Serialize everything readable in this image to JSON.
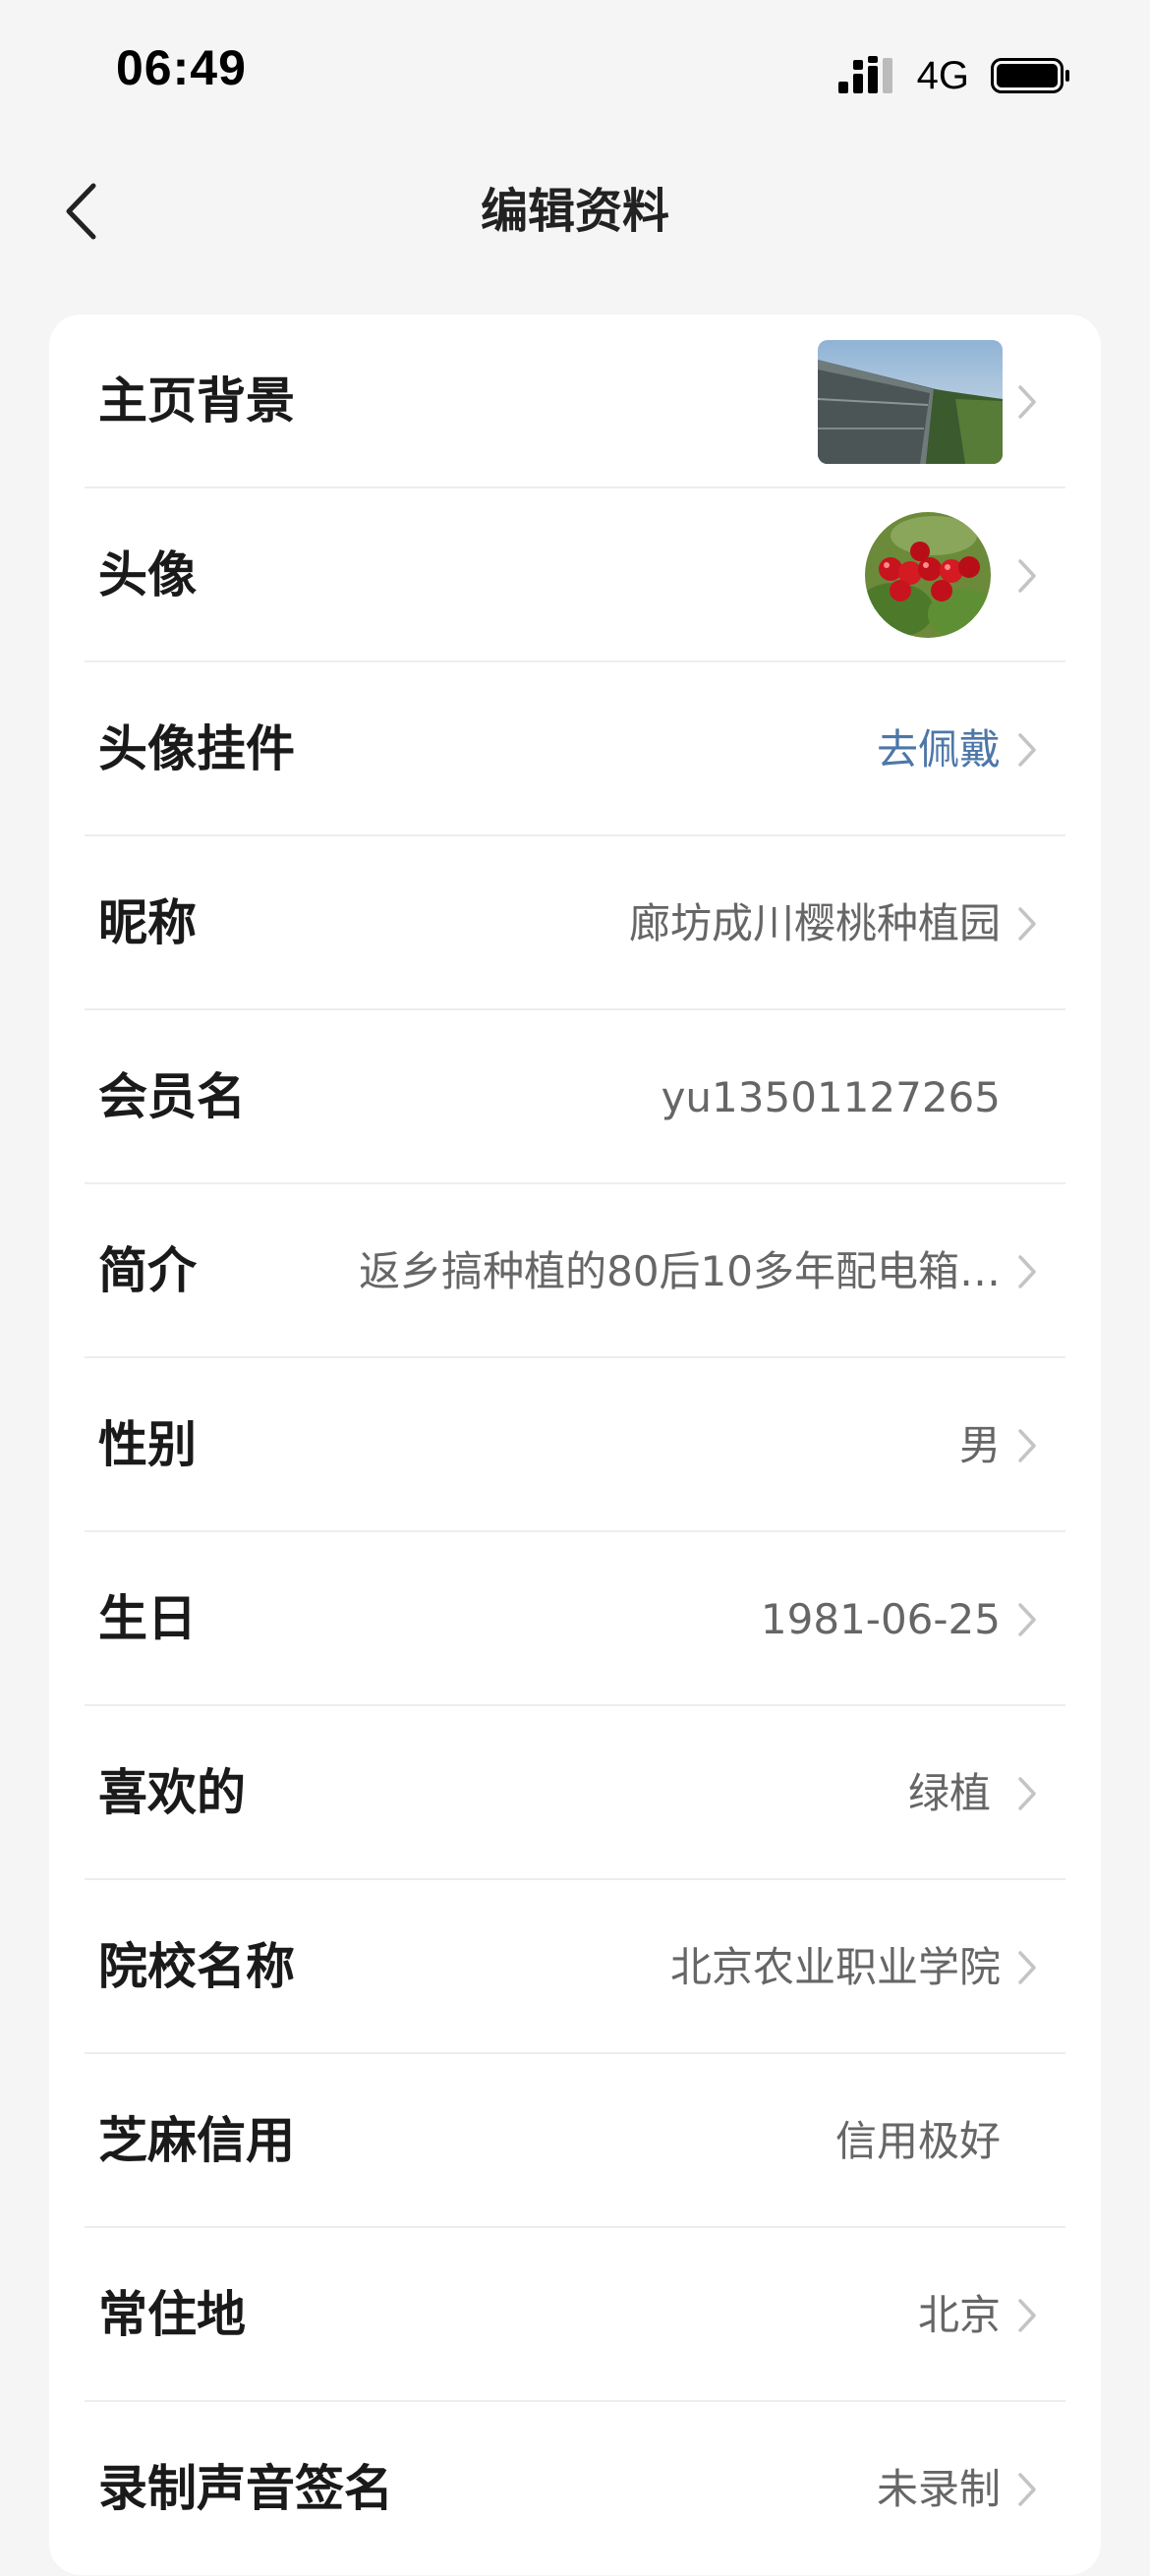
{
  "status_bar": {
    "time": "06:49",
    "network": "4G",
    "signal_icon": "signal-icon",
    "battery_icon": "battery-icon"
  },
  "nav": {
    "title": "编辑资料",
    "back_icon": "chevron-left-icon"
  },
  "rows": [
    {
      "label": "主页背景",
      "value": "",
      "kind": "image",
      "chevron": true
    },
    {
      "label": "头像",
      "value": "",
      "kind": "avatar",
      "chevron": true
    },
    {
      "label": "头像挂件",
      "value": "去佩戴",
      "kind": "link",
      "chevron": true
    },
    {
      "label": "昵称",
      "value": "廊坊成川樱桃种植园",
      "kind": "text",
      "chevron": true
    },
    {
      "label": "会员名",
      "value": "yu13501127265",
      "kind": "text",
      "chevron": false
    },
    {
      "label": "简介",
      "value": "返乡搞种植的80后10多年配电箱…",
      "kind": "text",
      "chevron": true
    },
    {
      "label": "性别",
      "value": "男",
      "kind": "text",
      "chevron": true
    },
    {
      "label": "生日",
      "value": "1981-06-25",
      "kind": "text",
      "chevron": true
    },
    {
      "label": "喜欢的",
      "value": "绿植",
      "kind": "text",
      "chevron": true
    },
    {
      "label": "院校名称",
      "value": "北京农业职业学院",
      "kind": "text",
      "chevron": true
    },
    {
      "label": "芝麻信用",
      "value": "信用极好",
      "kind": "text",
      "chevron": false
    },
    {
      "label": "常住地",
      "value": "北京",
      "kind": "text",
      "chevron": true
    },
    {
      "label": "录制声音签名",
      "value": "未录制",
      "kind": "text",
      "chevron": true
    }
  ],
  "colors": {
    "background": "#f5f5f5",
    "card": "#ffffff",
    "label": "#1a1a1a",
    "value": "#666666",
    "link": "#4d77a8",
    "divider": "#ededed"
  }
}
